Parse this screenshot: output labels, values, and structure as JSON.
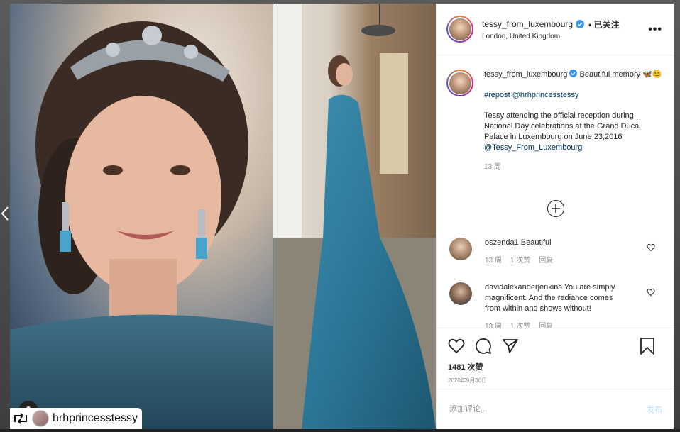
{
  "header": {
    "username": "tessy_from_luxembourg",
    "follow_state": "• 已关注",
    "location": "London, United Kingdom",
    "more_label": "•••"
  },
  "caption": {
    "username": "tessy_from_luxembourg",
    "text": "Beautiful memory 🦋😊",
    "hashtag": "#repost",
    "repost_mention": "@hrhprincesstessy",
    "body": "Tessy attending the official reception during National Day celebrations at the Grand Ducal Palace in Luxembourg on June 23,2016",
    "mention": "@Tessy_From_Luxembourg",
    "time": "13 周"
  },
  "comments": [
    {
      "username": "oszenda1",
      "text": "Beautiful",
      "time": "13 周",
      "likes": "1 次赞",
      "reply": "回复"
    },
    {
      "username": "davidalexanderjenkins",
      "text": "You are simply magnificent. And the radiance comes from within and shows without!",
      "time": "13 周",
      "likes": "1 次赞",
      "reply": "回复"
    }
  ],
  "stats": {
    "likes": "1481 次赞",
    "date": "2020年9月30日"
  },
  "comment_form": {
    "placeholder": "添加评论...",
    "post_label": "发布"
  },
  "media": {
    "repost_tag": "hrhprincesstessy"
  },
  "colors": {
    "link": "#00376b",
    "verified": "#3897f0",
    "muted": "#8e8e8e",
    "post_button": "#b2dffc"
  }
}
